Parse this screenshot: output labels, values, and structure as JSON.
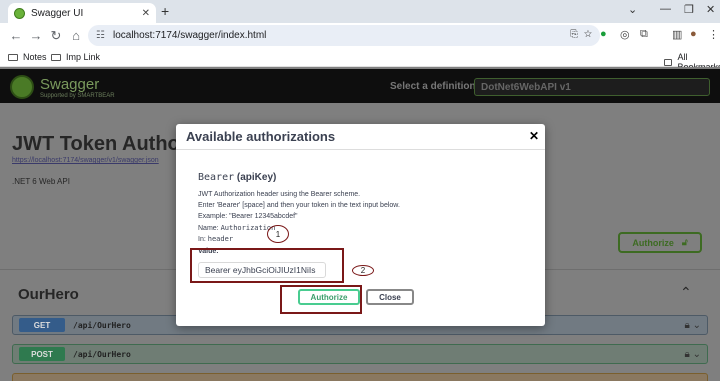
{
  "browser": {
    "tab_title": "Swagger UI",
    "tab_close": "✕",
    "new_tab": "+",
    "address": "localhost:7174/swagger/index.html",
    "window_controls": [
      "⌄",
      "—",
      "❐",
      "✕"
    ]
  },
  "bookmarks": {
    "items": [
      "Notes",
      "Imp Link"
    ],
    "all_bookmarks": "All Bookmarks"
  },
  "swagger": {
    "logo_text": "Swagger",
    "logo_sub": "Supported by SMARTBEAR",
    "select_label": "Select a definition",
    "select_value": "DotNet6WebAPI v1",
    "title": "JWT Token Autho",
    "url": "https://localhost:7174/swagger/v1/swagger.json",
    "description": ".NET 6 Web API",
    "authorize_label": "Authorize",
    "section": "OurHero",
    "operations": [
      {
        "method": "GET",
        "path": "/api/OurHero"
      },
      {
        "method": "POST",
        "path": "/api/OurHero"
      },
      {
        "method": "",
        "path": ""
      }
    ]
  },
  "modal": {
    "title": "Available authorizations",
    "close_glyph": "✕",
    "scheme_name": "Bearer",
    "scheme_type": "(apiKey)",
    "description_lines": [
      "JWT Authorization header using the Bearer scheme.",
      "Enter 'Bearer' [space] and then your token in the text input below.",
      "Example: \"Bearer 12345abcdef\""
    ],
    "name_label": "Name:",
    "name_value": "Authorization",
    "in_label": "In:",
    "in_value": "header",
    "value_label": "Value:",
    "value_input": "Bearer eyJhbGciOiJIUzI1NiIs",
    "authorize_button": "Authorize",
    "close_button": "Close"
  },
  "annotations": {
    "marker_1": "1",
    "marker_2": "2",
    "color": "#7a1818"
  },
  "colors": {
    "swagger_green": "#49cc90",
    "get_blue": "#61affe",
    "post_green": "#49cc90"
  }
}
